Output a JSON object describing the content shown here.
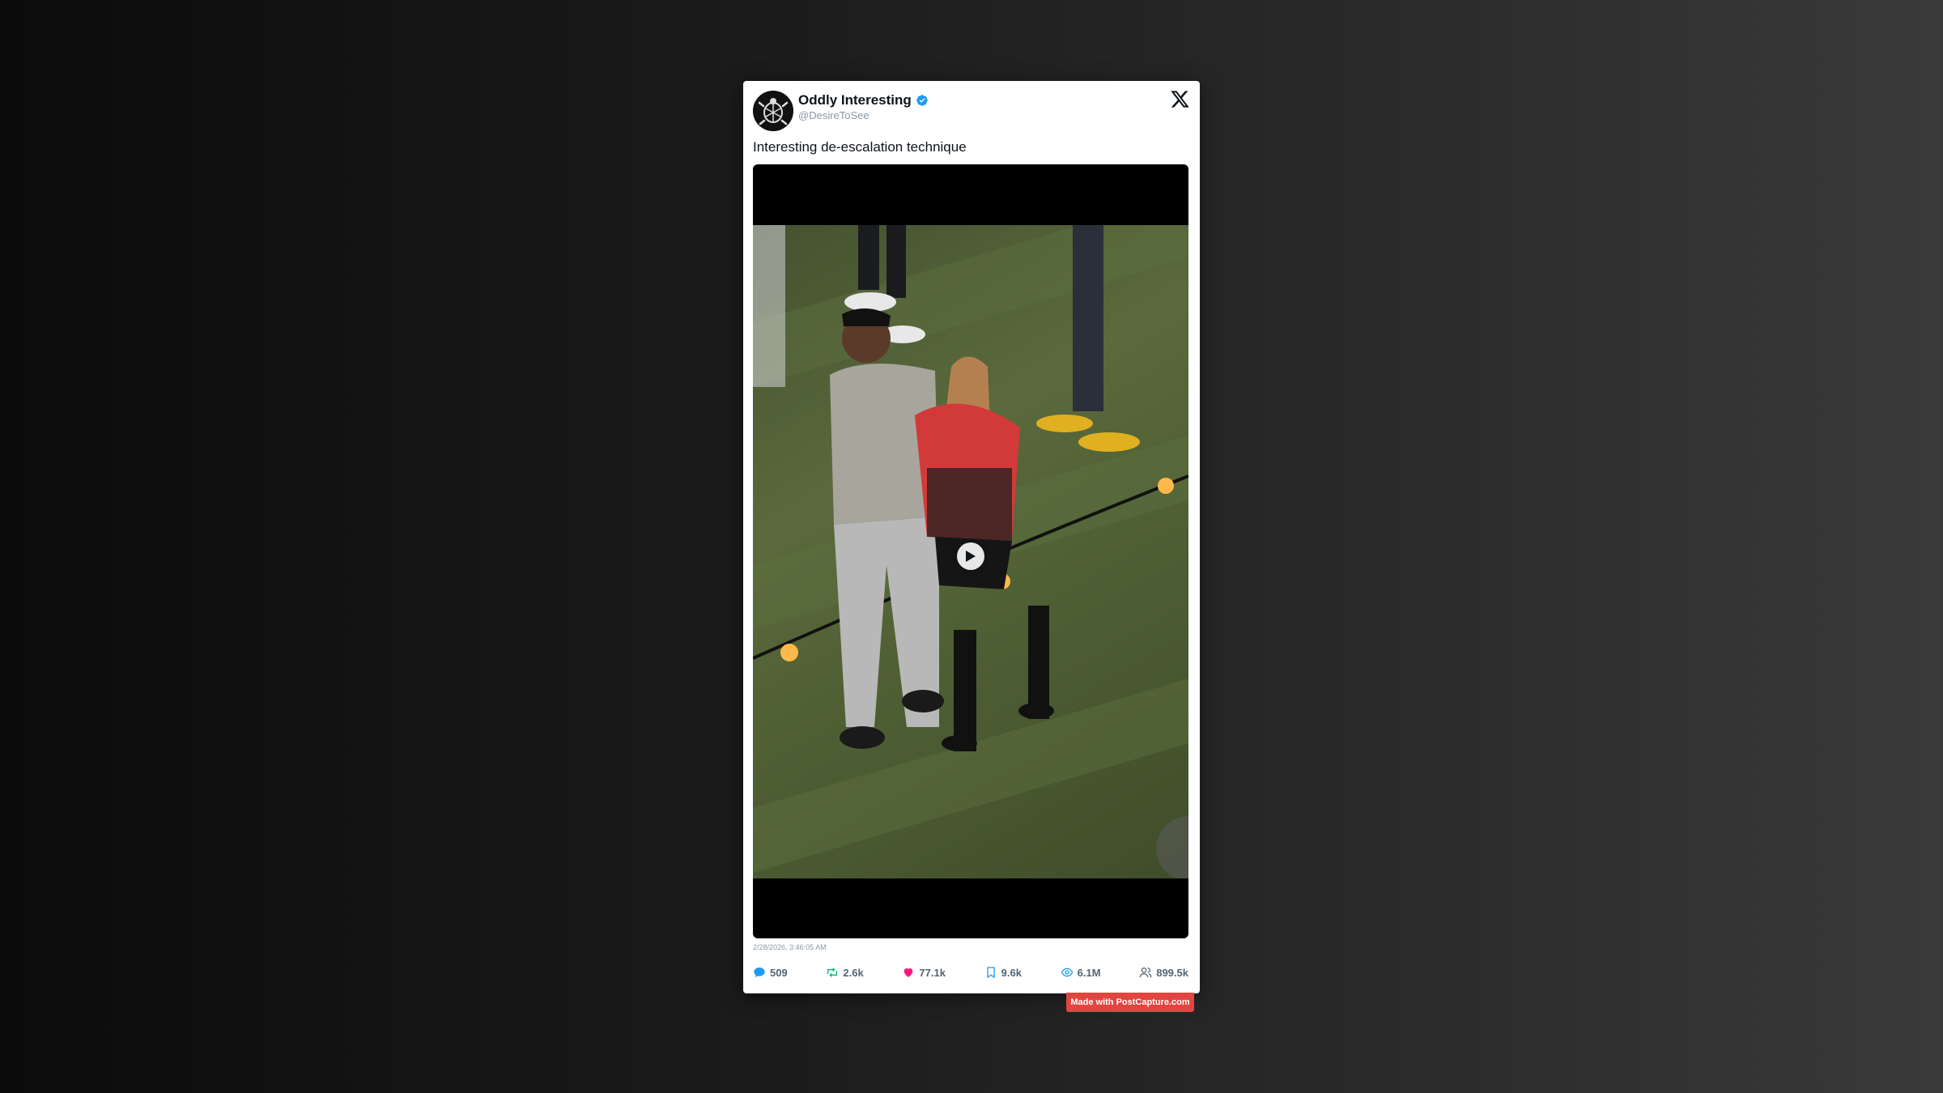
{
  "author": {
    "display_name": "Oddly Interesting",
    "handle": "@DesireToSee",
    "verified": true
  },
  "tweet": {
    "text": "Interesting de-escalation technique",
    "timestamp": "2/28/2026, 3:46:05 AM"
  },
  "stats": {
    "replies": "509",
    "retweets": "2.6k",
    "likes": "77.1k",
    "bookmarks": "9.6k",
    "views": "6.1M",
    "followers": "899.5k"
  },
  "watermark": {
    "text": "Made with PostCapture.com"
  },
  "icons": {
    "close": "x-logo-icon",
    "verified": "verified-badge-icon",
    "play": "play-icon",
    "reply": "reply-icon",
    "retweet": "retweet-icon",
    "like": "heart-icon",
    "bookmark": "bookmark-icon",
    "views": "eye-icon",
    "followers": "followers-icon"
  },
  "colors": {
    "verified": "#1d9bf0",
    "reply": "#1d9bf0",
    "retweet": "#00ba7c",
    "like": "#f91880",
    "bookmark": "#1d9bf0",
    "views": "#1d9bf0",
    "watermark_bg": "#e0463f"
  }
}
